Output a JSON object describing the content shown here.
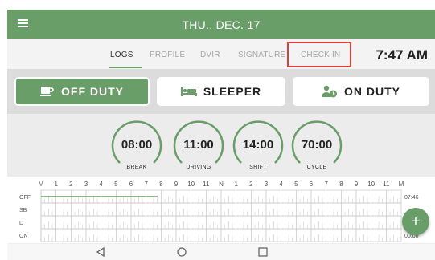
{
  "header": {
    "title": "THU., DEC. 17",
    "menu_icon": "hamburger-menu-icon",
    "theme_icon": "moon-icon"
  },
  "tabs": [
    {
      "label": "LOGS",
      "active": true
    },
    {
      "label": "PROFILE",
      "active": false
    },
    {
      "label": "DVIR",
      "active": false
    },
    {
      "label": "SIGNATURE",
      "active": false
    },
    {
      "label": "CHECK IN",
      "active": false,
      "highlighted": true
    }
  ],
  "clock": "7:47 AM",
  "status_buttons": [
    {
      "label": "OFF DUTY",
      "active": true,
      "icon": "coffee-cup-icon"
    },
    {
      "label": "SLEEPER",
      "active": false,
      "icon": "bed-icon"
    },
    {
      "label": "ON DUTY",
      "active": false,
      "icon": "driver-clock-icon"
    }
  ],
  "gauges": [
    {
      "value": "08:00",
      "label": "BREAK",
      "fraction": 1.0
    },
    {
      "value": "11:00",
      "label": "DRIVING",
      "fraction": 1.0
    },
    {
      "value": "14:00",
      "label": "SHIFT",
      "fraction": 1.0
    },
    {
      "value": "70:00",
      "label": "CYCLE",
      "fraction": 1.0
    }
  ],
  "log_grid": {
    "hour_labels": [
      "M",
      "1",
      "2",
      "3",
      "4",
      "5",
      "6",
      "7",
      "8",
      "9",
      "10",
      "11",
      "N",
      "1",
      "2",
      "3",
      "4",
      "5",
      "6",
      "7",
      "8",
      "9",
      "10",
      "11",
      "M"
    ],
    "row_labels": [
      "OFF",
      "SB",
      "D",
      "ON"
    ],
    "totals": [
      "07:46",
      "",
      "",
      "00:00"
    ],
    "off_duty_hours": 7.77,
    "accent_color": "#6a9e69"
  },
  "fab": {
    "label": "+"
  },
  "nav": {
    "back_icon": "back-triangle-icon",
    "home_icon": "home-circle-icon",
    "recents_icon": "recents-square-icon"
  },
  "colors": {
    "primary": "#6a9e69",
    "highlight_box": "#d9403a"
  }
}
